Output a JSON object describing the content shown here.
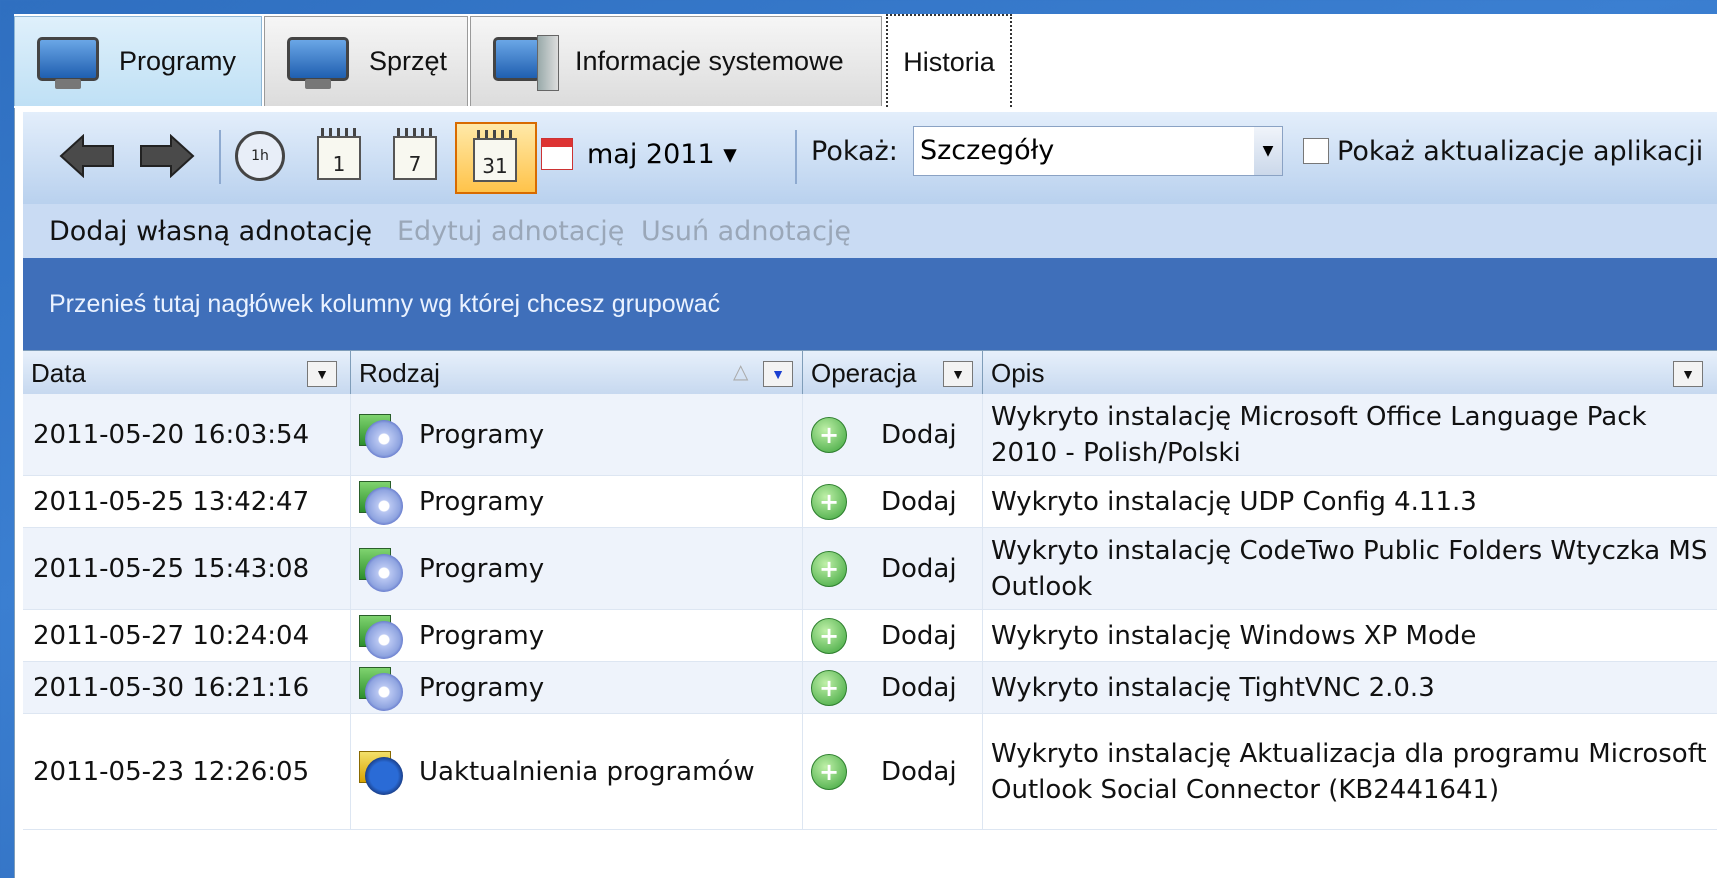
{
  "tabs": [
    {
      "label": "Programy",
      "icon": "monitor-icon"
    },
    {
      "label": "Sprzęt",
      "icon": "monitor-icon"
    },
    {
      "label": "Informacje systemowe",
      "icon": "computer-icon"
    },
    {
      "label": "Historia"
    }
  ],
  "toolbar": {
    "hour_icon_label": "1h",
    "cal_day": "1",
    "cal_week": "7",
    "cal_month": "31",
    "period_label": "maj 2011 ▾",
    "show_label": "Pokaż:",
    "show_value": "Szczegóły",
    "show_updates_label": "Pokaż aktualizacje aplikacji"
  },
  "annotations": {
    "add": "Dodaj własną adnotację",
    "edit": "Edytuj adnotację",
    "delete": "Usuń adnotację"
  },
  "group_hint": "Przenieś tutaj nagłówek kolumny wg której chcesz grupować",
  "columns": {
    "date": "Data",
    "kind": "Rodzaj",
    "op": "Operacja",
    "desc": "Opis"
  },
  "rows": [
    {
      "date": "2011-05-20 16:03:54",
      "kind": "Programy",
      "op": "Dodaj",
      "desc": "Wykryto instalację Microsoft Office Language Pack 2010 - Polish/Polski"
    },
    {
      "date": "2011-05-25 13:42:47",
      "kind": "Programy",
      "op": "Dodaj",
      "desc": "Wykryto instalację UDP Config 4.11.3"
    },
    {
      "date": "2011-05-25 15:43:08",
      "kind": "Programy",
      "op": "Dodaj",
      "desc": "Wykryto instalację CodeTwo Public Folders Wtyczka MS Outlook"
    },
    {
      "date": "2011-05-27 10:24:04",
      "kind": "Programy",
      "op": "Dodaj",
      "desc": "Wykryto instalację Windows XP Mode"
    },
    {
      "date": "2011-05-30 16:21:16",
      "kind": "Programy",
      "op": "Dodaj",
      "desc": "Wykryto instalację TightVNC 2.0.3"
    },
    {
      "date": "2011-05-23 12:26:05",
      "kind": "Uaktualnienia programów",
      "op": "Dodaj",
      "desc": "Wykryto instalację Aktualizacja dla programu Microsoft Outlook Social Connector (KB2441641)"
    }
  ]
}
